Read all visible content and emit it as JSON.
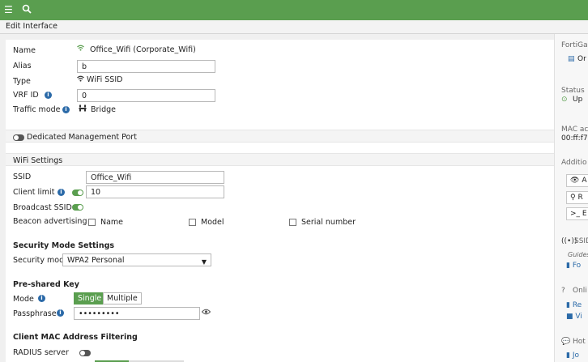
{
  "header": {
    "menu_icon": "hamburger-menu-icon",
    "search_icon": "search-icon"
  },
  "title": "Edit Interface",
  "form": {
    "name_label": "Name",
    "name_value": "Office_Wifi (Corporate_Wifi)",
    "alias_label": "Alias",
    "alias_value": "b",
    "type_label": "Type",
    "type_value": "WiFi SSID",
    "vrf_label": "VRF ID",
    "vrf_value": "0",
    "traffic_label": "Traffic mode",
    "traffic_value": "Bridge",
    "dedicated_label": "Dedicated Management Port",
    "wifi_section": "WiFi Settings",
    "ssid_label": "SSID",
    "ssid_value": "Office_Wifi",
    "client_limit_label": "Client limit",
    "client_limit_value": "10",
    "broadcast_label": "Broadcast SSID",
    "beacon_label": "Beacon advertising",
    "beacon_options": [
      "Name",
      "Model",
      "Serial number"
    ],
    "security_section": "Security Mode Settings",
    "security_mode_label": "Security mode",
    "security_mode_value": "WPA2 Personal",
    "psk_section": "Pre-shared Key",
    "mode_label": "Mode",
    "mode_single": "Single",
    "mode_multiple": "Multiple",
    "passphrase_label": "Passphrase",
    "passphrase_value": "•••••••••",
    "mac_section": "Client MAC Address Filtering",
    "radius_label": "RADIUS server"
  },
  "sidebar": {
    "fortigate": "FortiGa",
    "fortigate_item": "Or",
    "status_label": "Status",
    "status_value": "Up",
    "mac_label": "MAC ac",
    "mac_value": "00:ff:f7:",
    "additional_label": "Additio",
    "btn1": "A",
    "btn2": "R",
    "btn3": "E",
    "ssid_label": "SSID",
    "guides": "Guides",
    "guide_link": "Fo",
    "online_label": "Onli",
    "link_re": "Re",
    "link_vi": "Vi",
    "hot_label": "Hot",
    "link_jo": "Jo"
  },
  "colors": {
    "topbar": "#5a9e4f",
    "accent_green": "#5a9e4f",
    "info_blue": "#2b6aa8"
  }
}
